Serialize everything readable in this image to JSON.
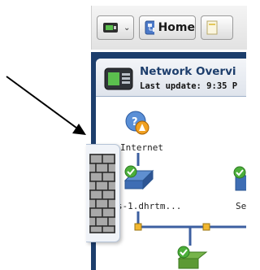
{
  "toolbar": {
    "home_label": "Home"
  },
  "network": {
    "title": "Network Overvi",
    "subtitle": "Last update: 9:35 P"
  },
  "nodes": {
    "internet_label": "Internet",
    "device1_label": "-cos-1.dhrtm...",
    "device2_label": "Se"
  },
  "colors": {
    "window_frame": "#1d3e6c",
    "connector": "#3c5fa0",
    "junction": "#f2b730",
    "status_ok": "#4caf3a"
  }
}
